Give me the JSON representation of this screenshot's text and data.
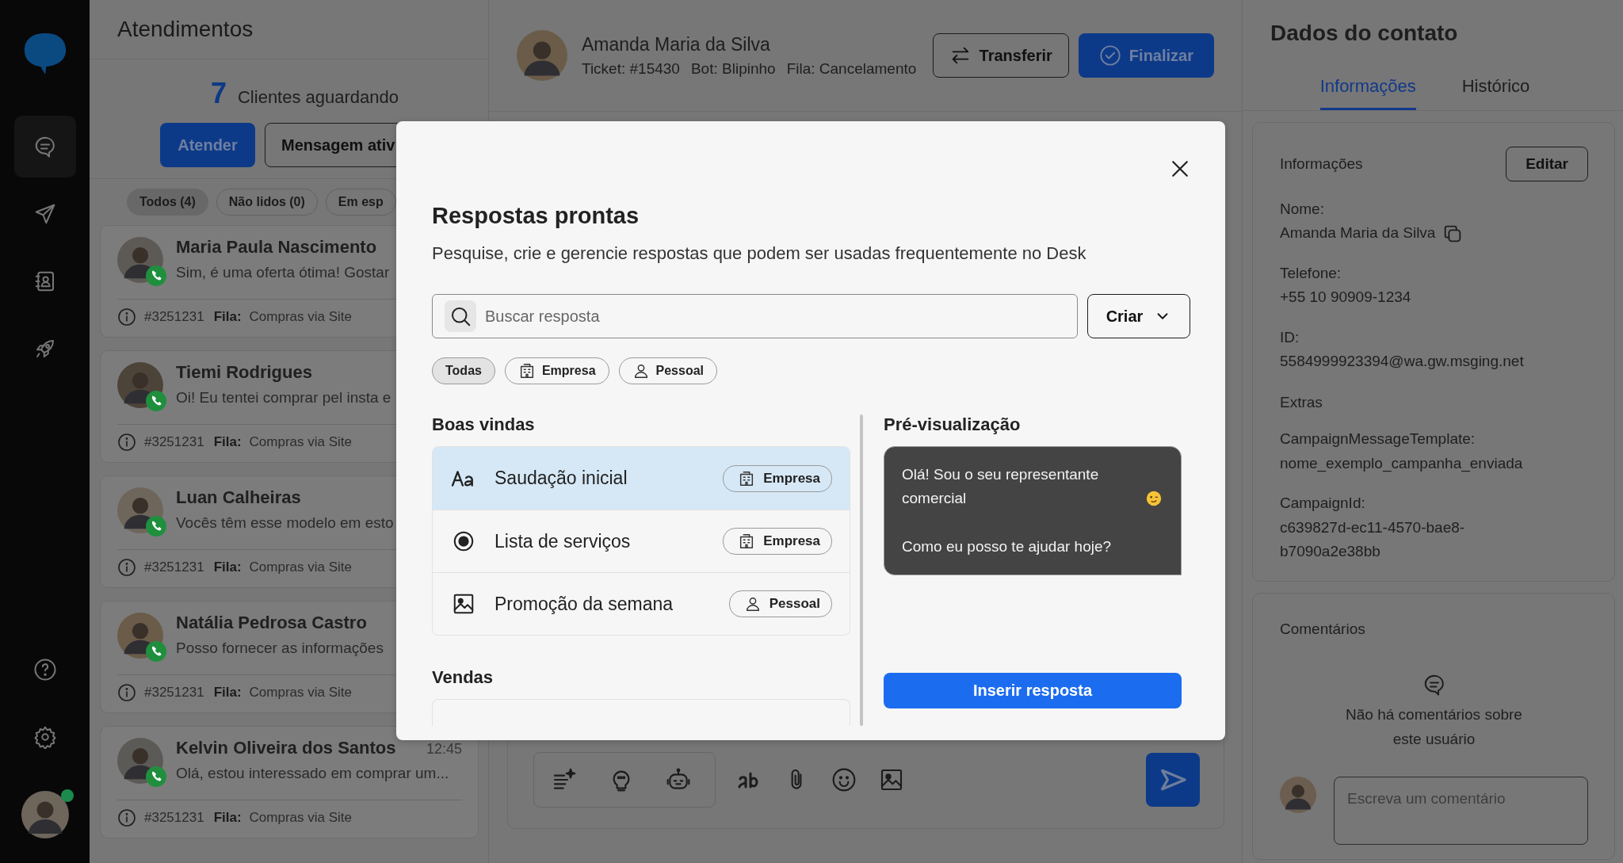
{
  "sidebar": {
    "nav_items": [
      {
        "kind": "chat",
        "selected": true
      },
      {
        "kind": "send",
        "selected": false
      },
      {
        "kind": "contacts",
        "selected": false
      },
      {
        "kind": "rocket",
        "selected": false
      }
    ],
    "bottom_items": [
      {
        "kind": "help"
      },
      {
        "kind": "settings"
      }
    ],
    "user": {
      "online": true
    }
  },
  "queue": {
    "title": "Atendimentos",
    "waiting_count": "7",
    "waiting_label": "Clientes aguardando",
    "buttons": [
      {
        "label": "Atender",
        "kind": "primary"
      },
      {
        "label": "Mensagem ativ",
        "kind": "outline"
      }
    ],
    "filters": [
      {
        "label": "Todos (4)",
        "selected": true
      },
      {
        "label": "Não lidos (0)",
        "selected": false
      },
      {
        "label": "Em esp",
        "selected": false
      }
    ],
    "conversations": [
      {
        "name": "Maria Paula Nascimento",
        "preview": "Sim, é uma oferta ótima! Gostar",
        "ticket": "#3251231",
        "queue_label": "Fila:",
        "queue": "Compras via Site"
      },
      {
        "name": "Tiemi Rodrigues",
        "preview": "Oi! Eu tentei comprar pel insta e",
        "ticket": "#3251231",
        "queue_label": "Fila:",
        "queue": "Compras via Site"
      },
      {
        "name": "Luan Calheiras",
        "preview": "Vocês têm esse modelo em esto",
        "ticket": "#3251231",
        "queue_label": "Fila:",
        "queue": "Compras via Site"
      },
      {
        "name": "Natália Pedrosa Castro",
        "preview": "Posso fornecer as informações",
        "ticket": "#3251231",
        "queue_label": "Fila:",
        "queue": "Compras via Site"
      },
      {
        "name": "Kelvin Oliveira dos Santos",
        "time": "12:45",
        "preview": "Olá, estou interessado em comprar um...",
        "ticket": "#3251231",
        "queue_label": "Fila:",
        "queue": "Compras via Site"
      }
    ]
  },
  "chat": {
    "contact": {
      "name": "Amanda Maria da Silva",
      "details": [
        {
          "label": "Ticket:",
          "value": "#15430"
        },
        {
          "label": "Bot:",
          "value": "Blipinho"
        },
        {
          "label": "Fila:",
          "value": "Cancelamento"
        }
      ]
    },
    "actions": [
      {
        "label": "Transferir",
        "kind": "outline"
      },
      {
        "label": "Finalizar",
        "kind": "primary"
      }
    ],
    "composer": {
      "ai_tools": [
        {
          "kind": "sparkle-list"
        },
        {
          "kind": "bulb"
        },
        {
          "kind": "robot"
        }
      ],
      "tools": [
        {
          "kind": "text-format"
        },
        {
          "kind": "clip"
        },
        {
          "kind": "emoji"
        },
        {
          "kind": "image"
        }
      ]
    }
  },
  "contact_panel": {
    "title": "Dados do contato",
    "tabs": [
      {
        "label": "Informações",
        "selected": true
      },
      {
        "label": "Histórico",
        "selected": false
      }
    ],
    "info": {
      "title": "Informações",
      "edit": "Editar",
      "fields": [
        {
          "label": "Nome:",
          "value": "Amanda Maria da Silva",
          "copyable": true
        },
        {
          "label": "Telefone:",
          "value": "+55 10 90909-1234",
          "copyable": false
        },
        {
          "label": "ID:",
          "value": "5584999923394@wa.gw.msging.net",
          "copyable": false
        }
      ],
      "extras_title": "Extras",
      "extras": [
        {
          "label": "CampaignMessageTemplate:",
          "value": "nome_exemplo_campanha_enviada"
        },
        {
          "label": "CampaignId:",
          "value": "c639827d-ec11-4570-bae8-b7090a2e38bb"
        }
      ]
    },
    "comments": {
      "title": "Comentários",
      "empty": "Não há comentários sobre este usuário",
      "placeholder": "Escreva um comentário"
    }
  },
  "modal": {
    "title": "Respostas prontas",
    "subtitle": "Pesquise, crie e gerencie respostas que podem ser usadas frequentemente no Desk",
    "search": {
      "placeholder": "Buscar resposta"
    },
    "create": "Criar",
    "filters": [
      {
        "label": "Todas",
        "kind": "all",
        "selected": true
      },
      {
        "label": "Empresa",
        "kind": "company",
        "selected": false
      },
      {
        "label": "Pessoal",
        "kind": "personal",
        "selected": false
      }
    ],
    "sections": [
      {
        "title": "Boas vindas",
        "items": [
          {
            "kind": "text",
            "title": "Saudação inicial",
            "selected": true,
            "tag": {
              "kind": "company",
              "label": "Empresa"
            }
          },
          {
            "kind": "list",
            "title": "Lista de serviços",
            "selected": false,
            "tag": {
              "kind": "company",
              "label": "Empresa"
            }
          },
          {
            "kind": "image",
            "title": "Promoção da semana",
            "selected": false,
            "tag": {
              "kind": "personal",
              "label": "Pessoal"
            }
          }
        ]
      },
      {
        "title": "Vendas",
        "more_below": true
      }
    ],
    "preview": {
      "title": "Pré-visualização",
      "paragraphs": [
        {
          "text": "Olá! Sou o seu representante comercial",
          "emoji": true
        },
        {
          "text": "Como eu posso te ajudar hoje?",
          "emoji": false
        }
      ],
      "insert": "Inserir resposta"
    }
  }
}
